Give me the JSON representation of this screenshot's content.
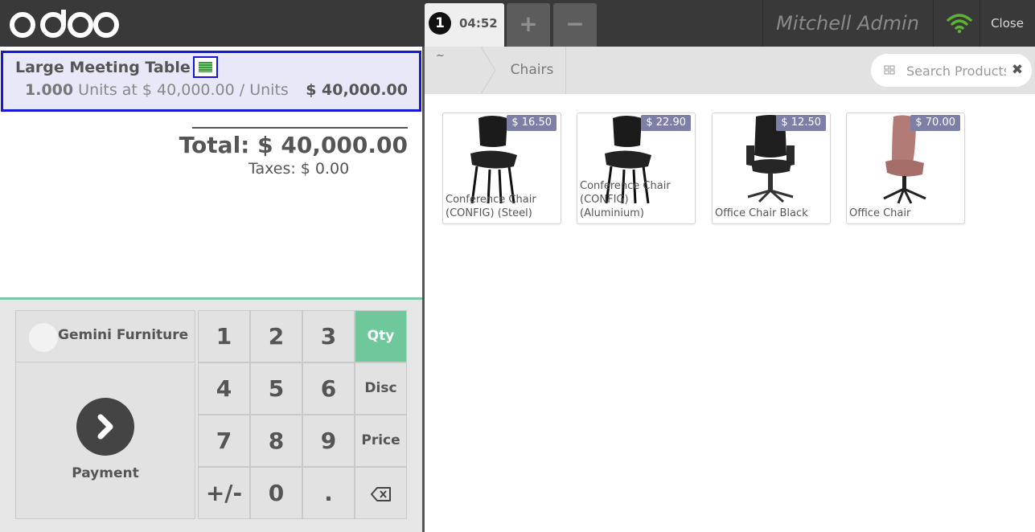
{
  "header": {
    "brand": "odoo",
    "order": {
      "number": "1",
      "time": "04:52"
    },
    "add_label": "+",
    "remove_label": "−",
    "user": "Mitchell Admin",
    "close_label": "Close",
    "colors": {
      "bar": "#393939",
      "wifi": "#5cb531"
    }
  },
  "order": {
    "line": {
      "name": "Large Meeting Table",
      "qty": "1.000",
      "qty_detail": "Units at $ 40,000.00 / Units",
      "price": "$ 40,000.00"
    },
    "total": "Total: $ 40,000.00",
    "taxes": "Taxes: $ 0.00"
  },
  "controls": {
    "customer": "Gemini Furniture",
    "payment_label": "Payment",
    "keys": {
      "k1": "1",
      "k2": "2",
      "k3": "3",
      "qty": "Qty",
      "k4": "4",
      "k5": "5",
      "k6": "6",
      "disc": "Disc",
      "k7": "7",
      "k8": "8",
      "k9": "9",
      "price": "Price",
      "plusminus": "+/-",
      "k0": "0",
      "dot": "."
    },
    "active_mode": "Qty",
    "active_color": "#6ec89b"
  },
  "products_panel": {
    "home_crumb": "~",
    "category": "Chairs",
    "search": {
      "placeholder": "Search Products...",
      "value": ""
    }
  },
  "products": [
    {
      "name": "Conference Chair (CONFIG) (Steel)",
      "price": "$ 16.50"
    },
    {
      "name": "Conference Chair (CONFIG) (Aluminium)",
      "price": "$ 22.90"
    },
    {
      "name": "Office Chair Black",
      "price": "$ 12.50"
    },
    {
      "name": "Office Chair",
      "price": "$ 70.00"
    }
  ]
}
